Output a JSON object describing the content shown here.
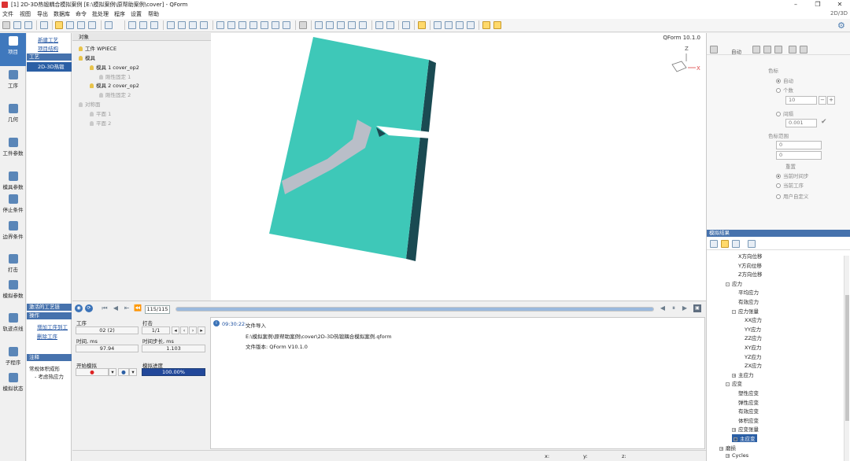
{
  "titlebar": {
    "title": "[1] 2D-3D热锻耦合模拟案例  [E:\\模拟案例\\原帮助案例\\cover] - QForm",
    "right_label": "2D/3D"
  },
  "menu": [
    "文件",
    "视图",
    "导出",
    "数据库",
    "命令",
    "批处理",
    "程序",
    "设置",
    "帮助"
  ],
  "leftnav": [
    {
      "label": "项目",
      "icon": "project-icon"
    },
    {
      "label": "工序",
      "icon": "operation-icon"
    },
    {
      "label": "几何",
      "icon": "geometry-icon"
    },
    {
      "label": "工件参数",
      "icon": "workpiece-icon"
    },
    {
      "label": "模具参数",
      "icon": "tool-icon"
    },
    {
      "label": "停止条件",
      "icon": "stop-icon"
    },
    {
      "label": "边界条件",
      "icon": "boundary-icon"
    },
    {
      "label": "打击",
      "icon": "blow-icon"
    },
    {
      "label": "模拟参数",
      "icon": "simparam-icon"
    },
    {
      "label": "轨迹点线",
      "icon": "trace-icon"
    },
    {
      "label": "子程序",
      "icon": "subroutine-icon"
    },
    {
      "label": "模拟状态",
      "icon": "simstate-icon"
    }
  ],
  "process": {
    "new_process": "新建工艺",
    "project_structure": "项目结构",
    "process_header": "工艺",
    "selected_item": "2D-3D热锻",
    "activated_header": "激活的工艺链",
    "operation_header": "操作",
    "add_operation": "增加工序到工",
    "delete_operation": "删除工序",
    "notes_header": "注释",
    "note_line1": "常规体积成形",
    "note_line2": "- 考虑热应力"
  },
  "tree": {
    "header": "对象",
    "nodes": [
      {
        "label": "工件 WPIECE",
        "dim": false
      },
      {
        "label": "模具",
        "dim": false
      },
      {
        "label": "模具 1 cover_op2",
        "dim": false
      },
      {
        "label": "刚性固定 1",
        "dim": true
      },
      {
        "label": "模具 2 cover_op2",
        "dim": false
      },
      {
        "label": "刚性固定 2",
        "dim": true
      },
      {
        "label": "对称面",
        "dim": true
      },
      {
        "label": "平面 1",
        "dim": true
      },
      {
        "label": "平面 2",
        "dim": true
      }
    ]
  },
  "viewport": {
    "version_label": "QForm 10.1.0",
    "axis_z": "Z",
    "axis_x": "X"
  },
  "color_panel": {
    "color_label": "色标",
    "auto": "自动",
    "count": "个数",
    "count_value": "10",
    "interval": "间隔",
    "interval_value": "0.001",
    "range_label": "色标范围",
    "range_min": "0",
    "range_max": "0",
    "reset": "重置",
    "option1": "当前时间步",
    "option2": "当前工序",
    "option3": "用户自定义",
    "toolbar_label": "自动"
  },
  "results": {
    "header": "模拟结果",
    "items": [
      {
        "label": "X方向位移",
        "indent": 2,
        "expand": "",
        "selected": false
      },
      {
        "label": "Y方向位移",
        "indent": 2,
        "expand": "",
        "selected": false
      },
      {
        "label": "Z方向位移",
        "indent": 2,
        "expand": "",
        "selected": false
      },
      {
        "label": "应力",
        "indent": 0,
        "expand": "-",
        "selected": false
      },
      {
        "label": "平均应力",
        "indent": 2,
        "expand": "",
        "selected": false
      },
      {
        "label": "有效应力",
        "indent": 2,
        "expand": "",
        "selected": false
      },
      {
        "label": "应力张量",
        "indent": 1,
        "expand": "-",
        "selected": false
      },
      {
        "label": "XX应力",
        "indent": 3,
        "expand": "",
        "selected": false
      },
      {
        "label": "YY应力",
        "indent": 3,
        "expand": "",
        "selected": false
      },
      {
        "label": "ZZ应力",
        "indent": 3,
        "expand": "",
        "selected": false
      },
      {
        "label": "XY应力",
        "indent": 3,
        "expand": "",
        "selected": false
      },
      {
        "label": "YZ应力",
        "indent": 3,
        "expand": "",
        "selected": false
      },
      {
        "label": "ZX应力",
        "indent": 3,
        "expand": "",
        "selected": false
      },
      {
        "label": "主应力",
        "indent": 1,
        "expand": "+",
        "selected": false
      },
      {
        "label": "应变",
        "indent": 0,
        "expand": "-",
        "selected": false
      },
      {
        "label": "塑性应变",
        "indent": 2,
        "expand": "",
        "selected": false
      },
      {
        "label": "弹性应变",
        "indent": 2,
        "expand": "",
        "selected": false
      },
      {
        "label": "有效应变",
        "indent": 2,
        "expand": "",
        "selected": false
      },
      {
        "label": "体积应变",
        "indent": 2,
        "expand": "",
        "selected": false
      },
      {
        "label": "应变张量",
        "indent": 1,
        "expand": "+",
        "selected": false
      },
      {
        "label": "主应变",
        "indent": 1,
        "expand": "+",
        "selected": true
      },
      {
        "label": "磨损",
        "indent": -1,
        "expand": "+",
        "selected": false
      },
      {
        "label": "Cycles",
        "indent": 0,
        "expand": "+",
        "selected": false
      }
    ]
  },
  "transport": {
    "step": "115/115",
    "progress_fraction": 1.0
  },
  "sim": {
    "operation_label": "工序",
    "operation_value": "02 (2)",
    "blow_label": "打击",
    "blow_value": "1/1",
    "time_label": "时间, ms",
    "time_value": "97.94",
    "timestep_label": "时间步长, ms",
    "timestep_value": "1.103",
    "start_label": "开始模拟",
    "progress_label": "模拟进度",
    "progress_value": "100.00%"
  },
  "log": {
    "time": "09:30:22:",
    "message": "文件导入",
    "path": "E:\\模拟案例\\原帮助案例\\cover\\2D-3D热锻耦合模拟案例.qform",
    "version": "文件版本: QForm V10.1.0"
  },
  "status": {
    "x": "x:",
    "y": "y:",
    "z": "z:"
  },
  "colors": {
    "part": "#3ec8b8",
    "part_side": "#1a4a52",
    "accent": "#2b5fa5"
  }
}
